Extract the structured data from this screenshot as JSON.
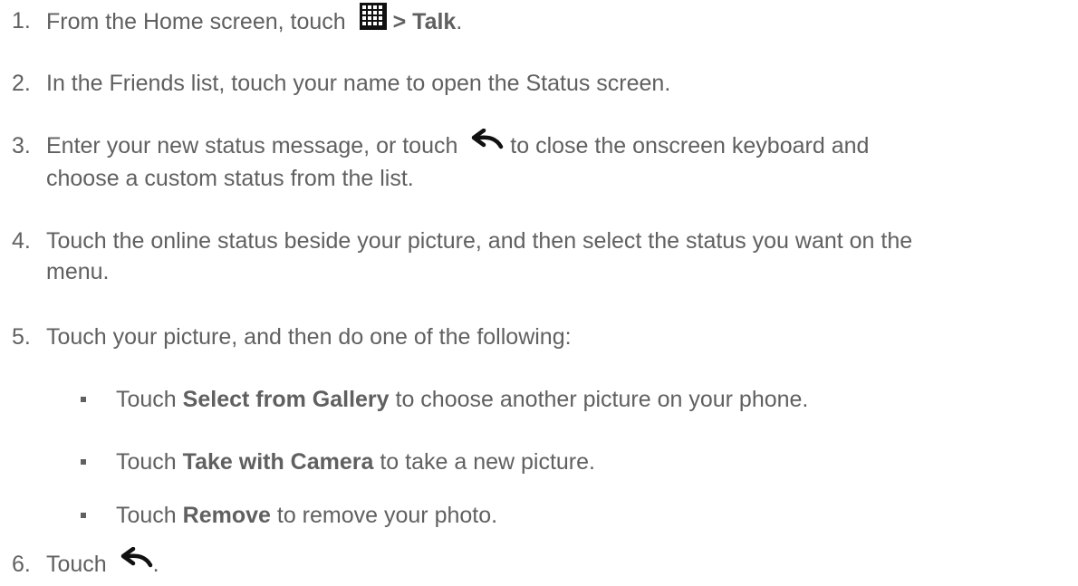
{
  "steps": [
    {
      "num": "1.",
      "pre": "From the Home screen, touch",
      "icon": "apps-grid-icon",
      "post_bold": " > Talk",
      "post": "."
    },
    {
      "num": "2.",
      "text": "In the Friends list, touch your name to open the Status screen."
    },
    {
      "num": "3.",
      "pre": "Enter your new status message, or touch",
      "icon": "back-arrow-icon",
      "post": " to close the onscreen keyboard and",
      "line2": "choose a custom status from the list."
    },
    {
      "num": "4.",
      "text": "Touch the online status beside your picture, and then select the status you want on the",
      "line2": "menu."
    },
    {
      "num": "5.",
      "text": "Touch your picture, and then do one of the following:"
    },
    {
      "num": "6.",
      "pre": "Touch",
      "icon": "back-arrow-icon",
      "post": "."
    }
  ],
  "bullets": [
    {
      "pre": "Touch ",
      "bold": "Select from Gallery",
      "post": " to choose another picture on your phone."
    },
    {
      "pre": "Touch ",
      "bold": "Take with Camera",
      "post": " to take a new picture."
    },
    {
      "pre": "Touch ",
      "bold": "Remove",
      "post": " to remove your photo."
    }
  ]
}
